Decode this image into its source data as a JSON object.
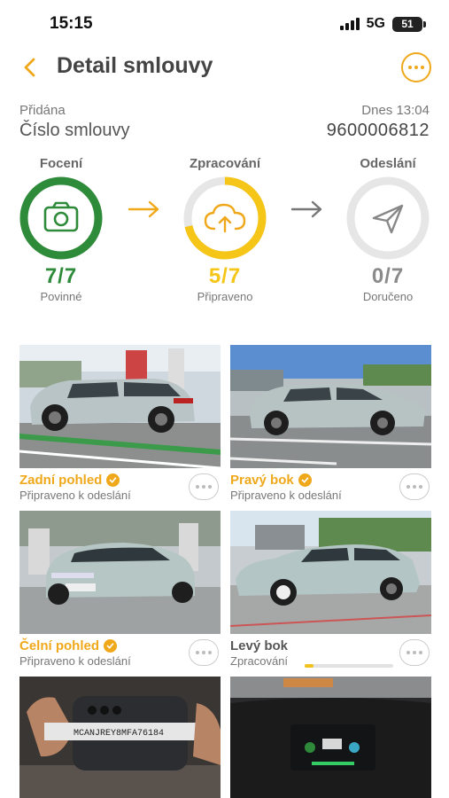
{
  "status_bar": {
    "time": "15:15",
    "network": "5G",
    "battery": "51"
  },
  "header": {
    "title": "Detail smlouvy"
  },
  "contract": {
    "added_label": "Přidána",
    "added_time": "Dnes 13:04",
    "number_label": "Číslo smlouvy",
    "number_value": "9600006812"
  },
  "steps": [
    {
      "label": "Focení",
      "count": "7/7",
      "sub": "Povinné",
      "progress": 1.0,
      "color": "#2e8b3a",
      "icon": "camera-icon"
    },
    {
      "label": "Zpracování",
      "count": "5/7",
      "sub": "Připraveno",
      "progress": 0.714,
      "color": "#f5c518",
      "icon": "cloud-upload-icon"
    },
    {
      "label": "Odeslání",
      "count": "0/7",
      "sub": "Doručeno",
      "progress": 0,
      "color": "#8a8a8a",
      "icon": "send-icon"
    }
  ],
  "photos": [
    {
      "title": "Zadní pohled",
      "status": "Připraveno k odeslání",
      "done": true
    },
    {
      "title": "Pravý bok",
      "status": "Připraveno k odeslání",
      "done": true
    },
    {
      "title": "Čelní pohled",
      "status": "Připraveno k odeslání",
      "done": true
    },
    {
      "title": "Levý bok",
      "status": "Zpracování",
      "done": false,
      "progress": 0.1
    },
    {
      "vin_text": "MCANJREY8MFA76184"
    },
    {}
  ],
  "colors": {
    "accent": "#f0a81b",
    "done": "#2e8b3a",
    "processing": "#f5c518",
    "pending": "#8a8a8a"
  }
}
